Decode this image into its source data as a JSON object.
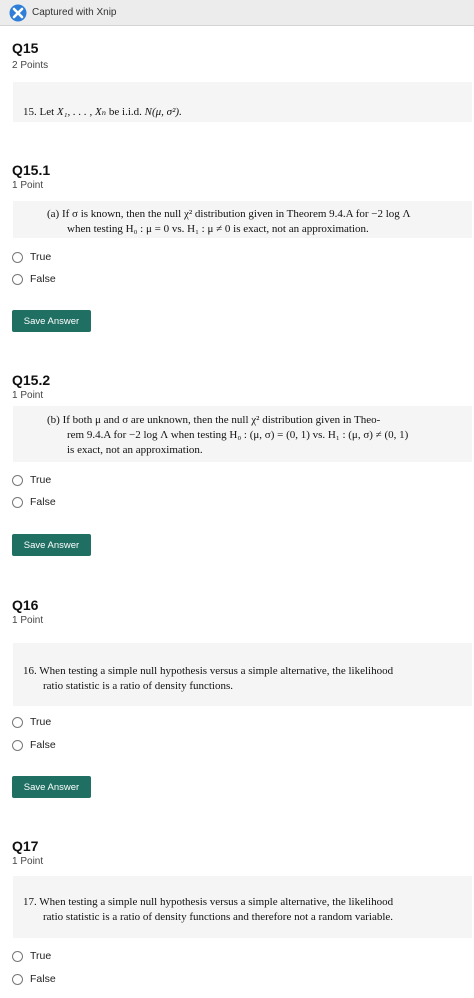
{
  "window": {
    "capture_label": "Captured with Xnip"
  },
  "questions": [
    {
      "id": "q15",
      "title": "Q15",
      "points": "2 Points",
      "text_prefix": "15. Let ",
      "text_main": "X₁, . . . , Xₙ",
      "text_rest": " be i.i.d. ",
      "text_dist": "N(μ, σ²)."
    },
    {
      "id": "q15_1",
      "title": "Q15.1",
      "points": "1 Point",
      "line1": "(a)  If σ is known, then the null χ² distribution given in Theorem 9.4.A for −2 log Λ",
      "line2": "when testing H₀ : μ = 0 vs. H₁ : μ ≠ 0 is exact, not an approximation.",
      "options": [
        "True",
        "False"
      ],
      "save_label": "Save Answer"
    },
    {
      "id": "q15_2",
      "title": "Q15.2",
      "points": "1 Point",
      "line1": "(b)  If both μ and σ are unknown, then the null χ² distribution given in Theo-",
      "line2": "rem 9.4.A for −2 log Λ when testing H₀ : (μ, σ) = (0, 1) vs. H₁ : (μ, σ) ≠ (0, 1)",
      "line3": "is exact, not an approximation.",
      "options": [
        "True",
        "False"
      ],
      "save_label": "Save Answer"
    },
    {
      "id": "q16",
      "title": "Q16",
      "points": "1 Point",
      "line1": "16.  When testing a simple null hypothesis versus a simple alternative, the likelihood",
      "line2": "ratio statistic is a ratio of density functions.",
      "options": [
        "True",
        "False"
      ],
      "save_label": "Save Answer"
    },
    {
      "id": "q17",
      "title": "Q17",
      "points": "1 Point",
      "line1": "17.  When testing a simple null hypothesis versus a simple alternative, the likelihood",
      "line2": "ratio statistic is a ratio of density functions and therefore not a random variable.",
      "options": [
        "True",
        "False"
      ]
    }
  ],
  "colors": {
    "accent": "#1f6f62",
    "box_bg": "#f5f5f5",
    "topbar_bg": "#ececec"
  }
}
